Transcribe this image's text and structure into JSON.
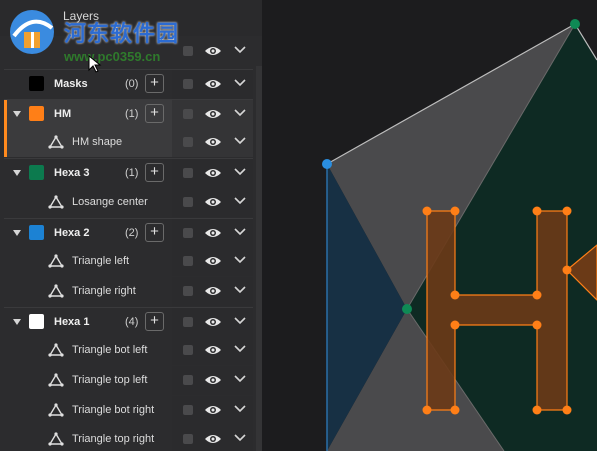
{
  "panel": {
    "title": "Layers",
    "rows": [
      {
        "kind": "group",
        "name": "Masks",
        "count": "(0)",
        "color": "#000000",
        "collapsed": true
      },
      {
        "kind": "group",
        "name": "HM",
        "count": "(1)",
        "color": "#ff7f17",
        "selected": true
      },
      {
        "kind": "child",
        "name": "HM shape",
        "selected": true
      },
      {
        "kind": "group",
        "name": "Hexa 3",
        "count": "(1)",
        "color": "#0c7a4e"
      },
      {
        "kind": "child",
        "name": "Losange center"
      },
      {
        "kind": "group",
        "name": "Hexa 2",
        "count": "(2)",
        "color": "#1c82d4"
      },
      {
        "kind": "child",
        "name": "Triangle left"
      },
      {
        "kind": "child",
        "name": "Triangle right"
      },
      {
        "kind": "group",
        "name": "Hexa 1",
        "count": "(4)",
        "color": "#ffffff"
      },
      {
        "kind": "child",
        "name": "Triangle bot left"
      },
      {
        "kind": "child",
        "name": "Triangle top left"
      },
      {
        "kind": "child",
        "name": "Triangle bot right"
      },
      {
        "kind": "child",
        "name": "Triangle top right"
      }
    ],
    "plus_label": "+"
  },
  "watermark": {
    "text": "河东软件园",
    "url": "www.pc0359.cn"
  },
  "colors": {
    "accent": "#ff8a1e",
    "hm_fill": "#6b3a17",
    "hexa3_fill": "#0f2a24",
    "hexa2_fill": "#1a3346",
    "node_orange": "#ff7f17",
    "node_blue": "#2a8ee0",
    "node_green": "#0f8a55"
  },
  "icons": [
    "triangle-icon",
    "eye-icon",
    "chevron-down-icon",
    "plus-icon",
    "caret-down-icon",
    "cursor-icon"
  ]
}
